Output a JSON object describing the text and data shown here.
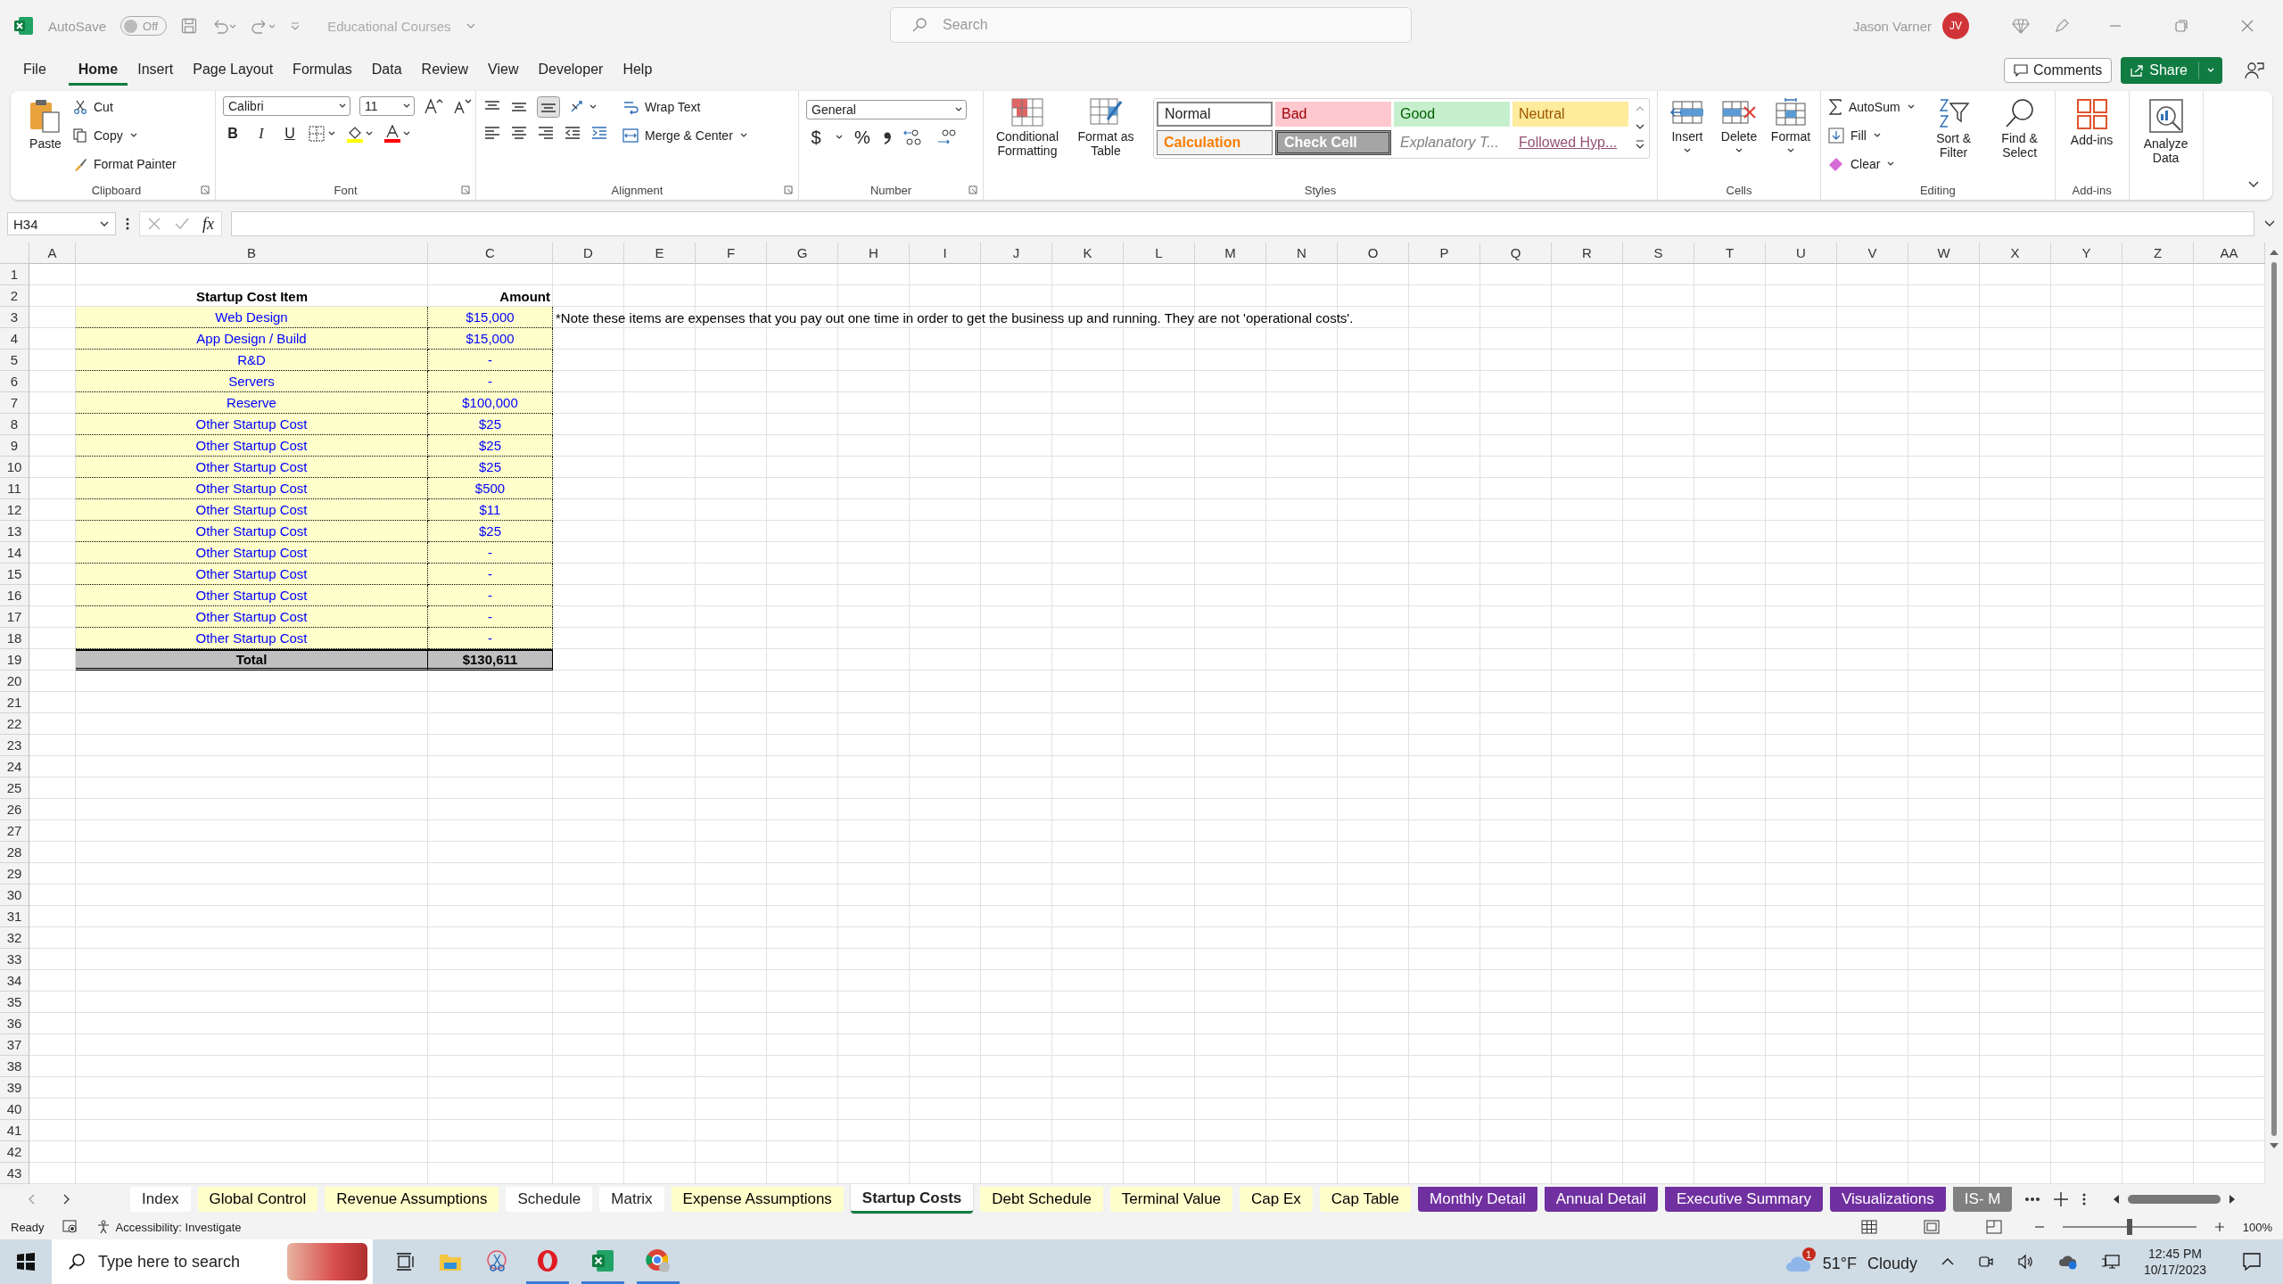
{
  "title_bar": {
    "autosave_label": "AutoSave",
    "autosave": {
      "label": "Off",
      "on": false
    },
    "file_name": "Educational Courses",
    "search": {
      "placeholder": "Search"
    },
    "user_name": "Jason Varner",
    "avatar_initials": "JV"
  },
  "menu_tabs": [
    {
      "label": "File",
      "selected": false
    },
    {
      "label": "Home",
      "selected": true
    },
    {
      "label": "Insert",
      "selected": false
    },
    {
      "label": "Page Layout",
      "selected": false
    },
    {
      "label": "Formulas",
      "selected": false
    },
    {
      "label": "Data",
      "selected": false
    },
    {
      "label": "Review",
      "selected": false
    },
    {
      "label": "View",
      "selected": false
    },
    {
      "label": "Developer",
      "selected": false
    },
    {
      "label": "Help",
      "selected": false
    }
  ],
  "comments_button": "Comments",
  "share_button": "Share",
  "ribbon": {
    "clipboard": {
      "label": "Clipboard",
      "paste": "Paste",
      "cut": "Cut",
      "copy": "Copy",
      "format_painter": "Format Painter"
    },
    "font": {
      "label": "Font",
      "font_name": "Calibri",
      "font_size": "11",
      "bold": "B",
      "italic": "I",
      "underline": "U"
    },
    "alignment": {
      "label": "Alignment",
      "wrap_text": "Wrap Text",
      "merge_center": "Merge & Center"
    },
    "number": {
      "label": "Number",
      "format": "General",
      "currency": "$",
      "percent": "%"
    },
    "styles": {
      "label": "Styles",
      "items": [
        {
          "label": "Normal",
          "kind": "normal"
        },
        {
          "label": "Bad",
          "kind": "bad"
        },
        {
          "label": "Good",
          "kind": "good"
        },
        {
          "label": "Neutral",
          "kind": "neutral"
        },
        {
          "label": "Calculation",
          "kind": "calculation"
        },
        {
          "label": "Check Cell",
          "kind": "check"
        },
        {
          "label": "Explanatory T...",
          "kind": "explanatory"
        },
        {
          "label": "Followed Hyp...",
          "kind": "followed"
        }
      ],
      "conditional_formatting": "Conditional Formatting",
      "format_as_table": "Format as Table"
    },
    "cells": {
      "label": "Cells",
      "insert": "Insert",
      "delete": "Delete",
      "format": "Format"
    },
    "editing": {
      "label": "Editing",
      "autosum": "AutoSum",
      "fill": "Fill",
      "clear": "Clear",
      "sort_filter": "Sort & Filter",
      "find_select": "Find & Select"
    },
    "addins": {
      "label": "Add-ins",
      "button": "Add-ins"
    },
    "analyze": {
      "button": "Analyze Data"
    }
  },
  "formula_bar": {
    "name_box": "H34",
    "fx": "fx"
  },
  "worksheet": {
    "columns": [
      "A",
      "B",
      "C",
      "D",
      "E",
      "F",
      "G",
      "H",
      "I",
      "J",
      "K",
      "L",
      "M",
      "N",
      "O",
      "P",
      "Q",
      "R",
      "S",
      "T",
      "U",
      "V",
      "W",
      "X",
      "Y",
      "Z",
      "AA"
    ],
    "row_numbers": [
      "1",
      "2",
      "3",
      "4",
      "5",
      "6",
      "7",
      "8",
      "9",
      "10",
      "11",
      "12",
      "13",
      "14",
      "15",
      "16",
      "17",
      "18",
      "19",
      "20",
      "21",
      "22",
      "23",
      "24",
      "25",
      "26",
      "27",
      "28",
      "29",
      "30",
      "31",
      "32",
      "33",
      "34",
      "35",
      "36",
      "37",
      "38",
      "39",
      "40",
      "41",
      "42",
      "43"
    ],
    "table": {
      "header": [
        "Startup Cost Item",
        "Amount"
      ],
      "rows": [
        {
          "item": "Web Design",
          "amount": "$15,000"
        },
        {
          "item": "App Design / Build",
          "amount": "$15,000"
        },
        {
          "item": "R&D",
          "amount": "-"
        },
        {
          "item": "Servers",
          "amount": "-"
        },
        {
          "item": "Reserve",
          "amount": "$100,000"
        },
        {
          "item": "Other Startup Cost",
          "amount": "$25"
        },
        {
          "item": "Other Startup Cost",
          "amount": "$25"
        },
        {
          "item": "Other Startup Cost",
          "amount": "$25"
        },
        {
          "item": "Other Startup Cost",
          "amount": "$500"
        },
        {
          "item": "Other Startup Cost",
          "amount": "$11"
        },
        {
          "item": "Other Startup Cost",
          "amount": "$25"
        },
        {
          "item": "Other Startup Cost",
          "amount": "-"
        },
        {
          "item": "Other Startup Cost",
          "amount": "-"
        },
        {
          "item": "Other Startup Cost",
          "amount": "-"
        },
        {
          "item": "Other Startup Cost",
          "amount": "-"
        },
        {
          "item": "Other Startup Cost",
          "amount": "-"
        }
      ],
      "total": {
        "label": "Total",
        "amount": "$130,611"
      }
    },
    "note": "*Note these items are expenses that you pay out one time in order to get the business up and running. They are not 'operational costs'."
  },
  "sheet_tabs": [
    {
      "label": "Index",
      "selected": false
    },
    {
      "label": "Global Control",
      "color": "#ffffcc",
      "selected": false
    },
    {
      "label": "Revenue Assumptions",
      "color": "#ffffcc",
      "selected": false
    },
    {
      "label": "Schedule",
      "selected": false
    },
    {
      "label": "Matrix",
      "selected": false
    },
    {
      "label": "Expense Assumptions",
      "color": "#ffffcc",
      "selected": false
    },
    {
      "label": "Startup Costs",
      "selected": true
    },
    {
      "label": "Debt Schedule",
      "color": "#ffffcc",
      "selected": false
    },
    {
      "label": "Terminal Value",
      "color": "#ffffcc",
      "selected": false
    },
    {
      "label": "Cap Ex",
      "color": "#ffffcc",
      "selected": false
    },
    {
      "label": "Cap Table",
      "color": "#ffffcc",
      "selected": false
    },
    {
      "label": "Monthly Detail",
      "color": "#7030a0",
      "selected": false
    },
    {
      "label": "Annual Detail",
      "color": "#7030a0",
      "selected": false
    },
    {
      "label": "Executive Summary",
      "color": "#7030a0",
      "selected": false
    },
    {
      "label": "Visualizations",
      "color": "#7030a0",
      "selected": false
    },
    {
      "label": "IS- M",
      "color": "#808080",
      "selected": false
    }
  ],
  "status_bar": {
    "status": "Ready",
    "accessibility": "Accessibility: Investigate",
    "zoom": {
      "level": 0.5,
      "label": "100%"
    }
  },
  "taskbar": {
    "search": {
      "placeholder": "Type here to search"
    },
    "weather": {
      "badge": "1",
      "temperature": "51°F",
      "condition": "Cloudy"
    },
    "time": "12:45 PM",
    "date": "10/17/2023"
  }
}
